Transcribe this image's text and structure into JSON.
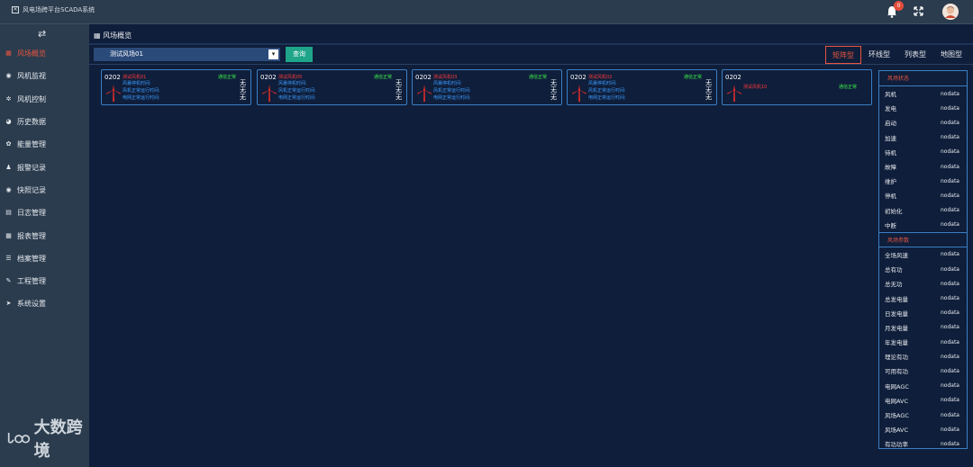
{
  "app": {
    "title": "风电场跨平台SCADA系统",
    "logo_glyph": "✕"
  },
  "topbar": {
    "notification_count": "0",
    "toggle_glyph": "⇄"
  },
  "sidebar": {
    "items": [
      {
        "label": "风场概览",
        "icon": "grid-icon",
        "glyph": "▦",
        "active": true
      },
      {
        "label": "风机监视",
        "icon": "camera-icon",
        "glyph": "◉"
      },
      {
        "label": "风机控制",
        "icon": "gear-icon",
        "glyph": "✲"
      },
      {
        "label": "历史数据",
        "icon": "pie-chart-icon",
        "glyph": "◕"
      },
      {
        "label": "能量管理",
        "icon": "tools-icon",
        "glyph": "✿"
      },
      {
        "label": "报警记录",
        "icon": "bell-icon",
        "glyph": "♟"
      },
      {
        "label": "快照记录",
        "icon": "camera-icon",
        "glyph": "◉"
      },
      {
        "label": "日志管理",
        "icon": "file-icon",
        "glyph": "▤"
      },
      {
        "label": "报表管理",
        "icon": "table-icon",
        "glyph": "▦"
      },
      {
        "label": "档案管理",
        "icon": "list-icon",
        "glyph": "☰"
      },
      {
        "label": "工程管理",
        "icon": "wrench-icon",
        "glyph": "✎"
      },
      {
        "label": "系统设置",
        "icon": "send-icon",
        "glyph": "➤"
      }
    ],
    "watermark": "大数跨境"
  },
  "main": {
    "breadcrumb": "风场概览",
    "breadcrumb_glyph": "▦",
    "farm_select": "测试风场01",
    "select_glyph": "▾",
    "query_label": "查询",
    "tabs": [
      {
        "label": "矩阵型",
        "active": true
      },
      {
        "label": "环线型"
      },
      {
        "label": "列表型"
      },
      {
        "label": "地图型"
      }
    ],
    "cards": [
      {
        "code": "0202",
        "name": "测试风机01",
        "status": "通信正常",
        "rows": [
          {
            "label": "风暴停机时间:",
            "value": "无"
          },
          {
            "label": "风机正常运行时间:",
            "value": "无"
          },
          {
            "label": "电网正常运行时间:",
            "value": "无"
          }
        ]
      },
      {
        "code": "0202",
        "name": "测试风机05",
        "status": "通信正常",
        "rows": [
          {
            "label": "风暴停机时间:",
            "value": "无"
          },
          {
            "label": "风机正常运行时间:",
            "value": "无"
          },
          {
            "label": "电网正常运行时间:",
            "value": "无"
          }
        ]
      },
      {
        "code": "0202",
        "name": "测试风机03",
        "status": "通信正常",
        "rows": [
          {
            "label": "风暴停机时间:",
            "value": "无"
          },
          {
            "label": "风机正常运行时间:",
            "value": "无"
          },
          {
            "label": "电网正常运行时间:",
            "value": "无"
          }
        ]
      },
      {
        "code": "0202",
        "name": "测试风机02",
        "status": "通信正常",
        "rows": [
          {
            "label": "风暴停机时间:",
            "value": "无"
          },
          {
            "label": "风机正常运行时间:",
            "value": "无"
          },
          {
            "label": "电网正常运行时间:",
            "value": "无"
          }
        ]
      },
      {
        "code": "0202",
        "name": "测试风机10",
        "status": "通信正常",
        "rows": []
      }
    ]
  },
  "panel": {
    "status_title": "风场状态",
    "status_rows": [
      {
        "label": "风机",
        "value": "nodata"
      },
      {
        "label": "发电",
        "value": "nodata"
      },
      {
        "label": "启动",
        "value": "nodata"
      },
      {
        "label": "加速",
        "value": "nodata"
      },
      {
        "label": "待机",
        "value": "nodata"
      },
      {
        "label": "故障",
        "value": "nodata"
      },
      {
        "label": "维护",
        "value": "nodata"
      },
      {
        "label": "停机",
        "value": "nodata"
      },
      {
        "label": "初始化",
        "value": "nodata"
      },
      {
        "label": "中断",
        "value": "nodata"
      }
    ],
    "params_title": "风场参数",
    "params_rows": [
      {
        "label": "全场风速",
        "value": "nodata"
      },
      {
        "label": "总有功",
        "value": "nodata"
      },
      {
        "label": "总无功",
        "value": "nodata"
      },
      {
        "label": "总发电量",
        "value": "nodata"
      },
      {
        "label": "日发电量",
        "value": "nodata"
      },
      {
        "label": "月发电量",
        "value": "nodata"
      },
      {
        "label": "年发电量",
        "value": "nodata"
      },
      {
        "label": "理论有功",
        "value": "nodata"
      },
      {
        "label": "可用有功",
        "value": "nodata"
      },
      {
        "label": "电网AGC",
        "value": "nodata"
      },
      {
        "label": "电网AVC",
        "value": "nodata"
      },
      {
        "label": "风场AGC",
        "value": "nodata"
      },
      {
        "label": "风场AVC",
        "value": "nodata"
      },
      {
        "label": "有功功率",
        "value": "nodata"
      }
    ]
  }
}
